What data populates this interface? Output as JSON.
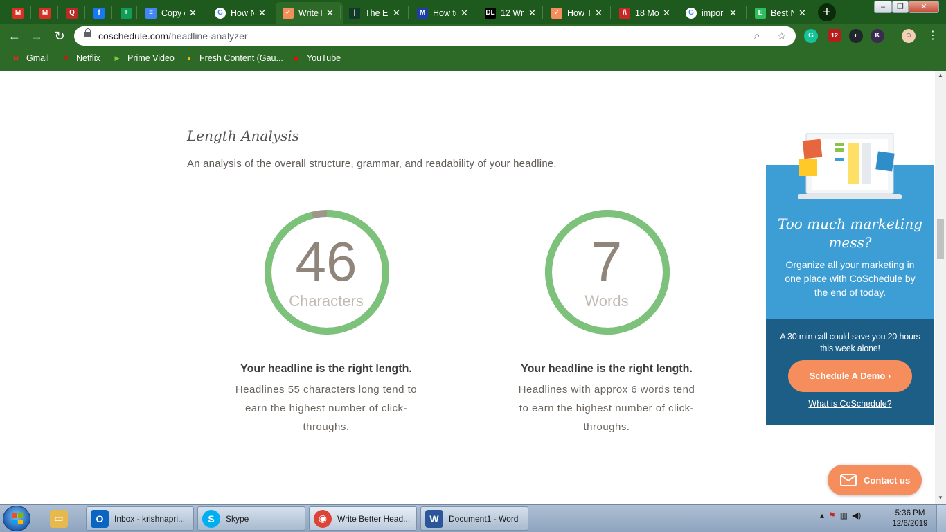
{
  "browser": {
    "tabs": [
      {
        "label": "",
        "favicon": "gmail-icon",
        "color": "#d93025",
        "glyph": "M"
      },
      {
        "label": "",
        "favicon": "gmail-icon",
        "color": "#d93025",
        "glyph": "M"
      },
      {
        "label": "",
        "favicon": "quora-icon",
        "color": "#b92b27",
        "glyph": "Q"
      },
      {
        "label": "",
        "favicon": "facebook-icon",
        "color": "#1877f2",
        "glyph": "f"
      },
      {
        "label": "",
        "favicon": "google-sheets-icon",
        "color": "#0f9d58",
        "glyph": "+"
      },
      {
        "label": "Copy o",
        "favicon": "google-docs-icon",
        "color": "#4285f4",
        "glyph": "≡"
      },
      {
        "label": "How N",
        "favicon": "google-icon",
        "color": "#ffffff",
        "glyph": "G"
      },
      {
        "label": "Write B",
        "favicon": "coschedule-icon",
        "color": "#f58d5c",
        "glyph": "✓"
      },
      {
        "label": "The Es",
        "favicon": "site-icon",
        "color": "#123a2a",
        "glyph": "|"
      },
      {
        "label": "How to",
        "favicon": "medium-icon",
        "color": "#1f3fa8",
        "glyph": "M"
      },
      {
        "label": "12 Wr",
        "favicon": "dl-icon",
        "color": "#000000",
        "glyph": "DL"
      },
      {
        "label": "How T",
        "favicon": "coschedule-icon",
        "color": "#f58d5c",
        "glyph": "✓"
      },
      {
        "label": "18 Mo",
        "favicon": "site-icon",
        "color": "#c62828",
        "glyph": "/\\"
      },
      {
        "label": "impor",
        "favicon": "google-icon",
        "color": "#ffffff",
        "glyph": "G"
      },
      {
        "label": "Best N",
        "favicon": "evernote-icon",
        "color": "#2dbe60",
        "glyph": "E"
      }
    ],
    "url_host": "coschedule.com",
    "url_path": "/headline-analyzer",
    "bookmarks": [
      {
        "label": "Gmail",
        "icon": "gmail-icon",
        "color": "#d93025",
        "glyph": "M"
      },
      {
        "label": "Netflix",
        "icon": "netflix-icon",
        "color": "#e50914",
        "glyph": "N"
      },
      {
        "label": "Prime Video",
        "icon": "prime-video-icon",
        "color": "#8ac33b",
        "glyph": "▶"
      },
      {
        "label": "Fresh Content (Gau...",
        "icon": "google-drive-icon",
        "color": "#fbbc04",
        "glyph": "▲"
      },
      {
        "label": "YouTube",
        "icon": "youtube-icon",
        "color": "#ff0000",
        "glyph": "▶"
      }
    ],
    "extension_badge": "12"
  },
  "analysis": {
    "title": "Length Analysis",
    "description": "An analysis of the overall structure, grammar, and readability of your headline.",
    "characters": {
      "value": "46",
      "unit": "Characters",
      "verdict": "Your headline is the right length.",
      "advice": "Headlines 55 characters long tend to earn the highest number of click-throughs.",
      "ring_fraction": 0.96
    },
    "words": {
      "value": "7",
      "unit": "Words",
      "verdict": "Your headline is the right length.",
      "advice": "Headlines with approx 6 words tend to earn the highest number of click-throughs.",
      "ring_fraction": 1.0
    },
    "ring_color": "#7dc27a",
    "ring_track_color": "#9e958b"
  },
  "ad": {
    "headline": "Too much marketing mess?",
    "body": "Organize all your marketing in one place with CoSchedule by the end of today.",
    "note": "A 30 min call could save you 20 hours this week alone!",
    "cta": "Schedule A Demo",
    "link": "What is CoSchedule?"
  },
  "contact_button": "Contact us",
  "taskbar": {
    "items": [
      {
        "label": "",
        "icon": "explorer-icon",
        "color": "#e7b94d",
        "glyph": "▭"
      },
      {
        "label": "Inbox - krishnapri...",
        "icon": "outlook-icon",
        "color": "#0a64c2",
        "glyph": "O"
      },
      {
        "label": "Skype",
        "icon": "skype-icon",
        "color": "#00aff0",
        "glyph": "S"
      },
      {
        "label": "Write Better Head...",
        "icon": "chrome-icon",
        "color": "#db4437",
        "glyph": "◉"
      },
      {
        "label": "Document1 - Word",
        "icon": "word-icon",
        "color": "#2b579a",
        "glyph": "W"
      }
    ],
    "time": "5:36 PM",
    "date": "12/6/2019"
  }
}
